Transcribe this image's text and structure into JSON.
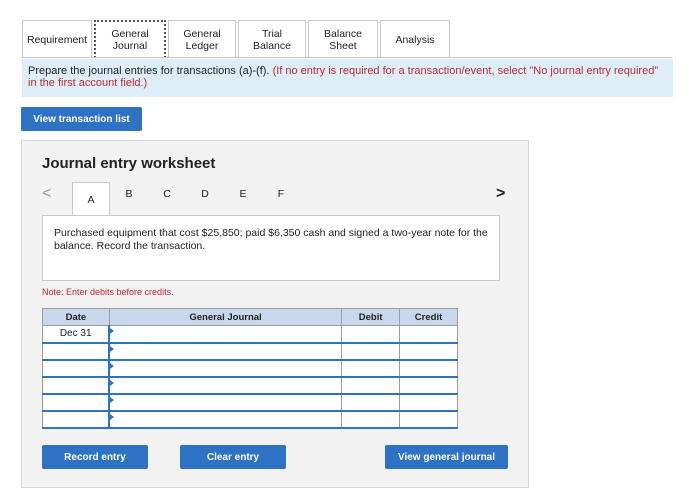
{
  "tabs": [
    {
      "label": "Requirement",
      "active": false
    },
    {
      "label": "General Journal",
      "active": true
    },
    {
      "label": "General Ledger",
      "active": false
    },
    {
      "label": "Trial Balance",
      "active": false
    },
    {
      "label": "Balance Sheet",
      "active": false
    },
    {
      "label": "Analysis",
      "active": false
    }
  ],
  "instruction": {
    "text": "Prepare the journal entries for transactions (a)-(f).",
    "note": "(If no entry is required for a transaction/event, select \"No journal entry required\" in the first account field.)"
  },
  "buttons": {
    "view_transaction_list": "View transaction list",
    "record_entry": "Record entry",
    "clear_entry": "Clear entry",
    "view_general_journal": "View general journal"
  },
  "worksheet": {
    "title": "Journal entry worksheet",
    "prev_icon": "<",
    "next_icon": ">",
    "letters": [
      "A",
      "B",
      "C",
      "D",
      "E",
      "F"
    ],
    "active_letter": "A",
    "description": "Purchased equipment that cost $25,850; paid $6,350 cash and signed a two-year note for the balance. Record the transaction.",
    "note": "Note: Enter debits before credits."
  },
  "table": {
    "headers": {
      "date": "Date",
      "general_journal": "General Journal",
      "debit": "Debit",
      "credit": "Credit"
    },
    "rows": [
      {
        "date": "Dec 31",
        "account": "",
        "debit": "",
        "credit": ""
      },
      {
        "date": "",
        "account": "",
        "debit": "",
        "credit": ""
      },
      {
        "date": "",
        "account": "",
        "debit": "",
        "credit": ""
      },
      {
        "date": "",
        "account": "",
        "debit": "",
        "credit": ""
      },
      {
        "date": "",
        "account": "",
        "debit": "",
        "credit": ""
      },
      {
        "date": "",
        "account": "",
        "debit": "",
        "credit": ""
      }
    ]
  },
  "colors": {
    "accent": "#2d72c4",
    "header_bg": "#c8d8ec",
    "instruction_bg": "#deeef9",
    "red": "#c0282e"
  }
}
